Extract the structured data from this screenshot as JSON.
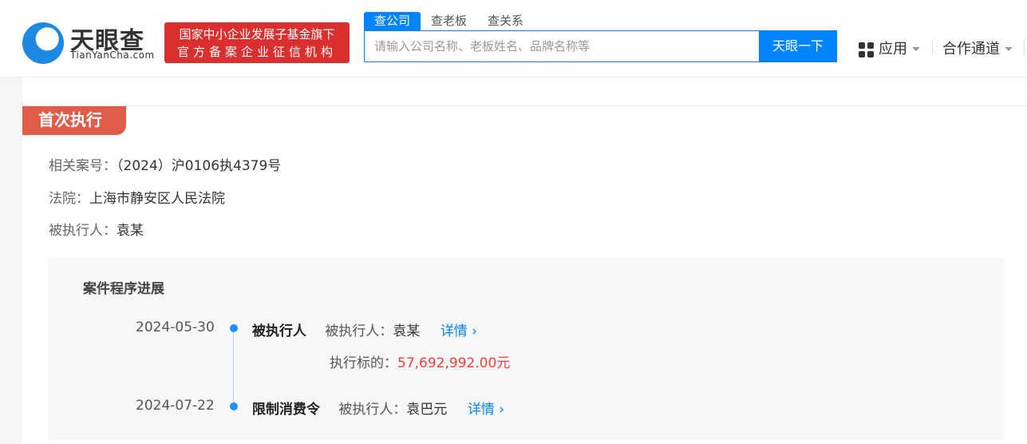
{
  "header": {
    "brand": "天眼查",
    "brand_sub": "TianYanCha.com",
    "badge_line1": "国家中小企业发展子基金旗下",
    "badge_line2": "官方备案企业征信机构",
    "tabs": [
      "查公司",
      "查老板",
      "查关系"
    ],
    "search_placeholder": "请输入公司名称、老板姓名、品牌名称等",
    "search_button": "天眼一下",
    "nav_apps": "应用",
    "nav_partner": "合作通道"
  },
  "section": {
    "title": "首次执行",
    "case_label": "相关案号：",
    "case_value": "（2024）沪0106执4379号",
    "court_label": "法院：",
    "court_value": "上海市静安区人民法院",
    "executee_label": "被执行人：",
    "executee_value": "袁某"
  },
  "progress": {
    "title": "案件程序进展",
    "events": [
      {
        "date": "2024-05-30",
        "type": "被执行人",
        "person_label": "被执行人：",
        "person": "袁某",
        "detail": "详情",
        "amount_label": "执行标的：",
        "amount": "57,692,992.00元"
      },
      {
        "date": "2024-07-22",
        "type": "限制消费令",
        "person_label": "被执行人：",
        "person": "袁巴元",
        "detail": "详情"
      }
    ]
  },
  "colors": {
    "accent": "#0084ff",
    "title_bg": "#e05c48",
    "amount": "#f0403c"
  }
}
